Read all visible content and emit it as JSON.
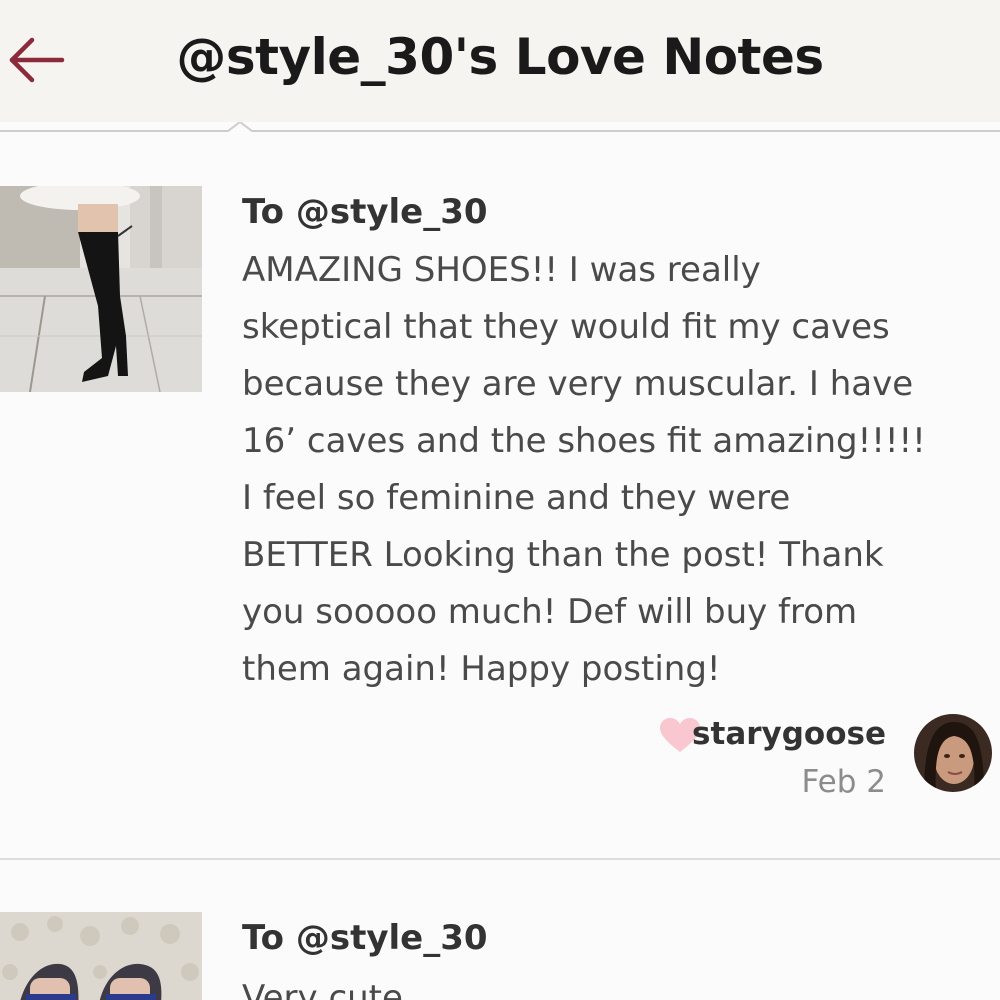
{
  "header": {
    "title": "@style_30's Love Notes",
    "back_icon": "left-arrow-icon",
    "accent_color": "#8b2a3a"
  },
  "notes": [
    {
      "to": "To @style_30",
      "body_lines": [
        "AMAZING SHOES!! I was really",
        "skeptical that they would fit my caves",
        "because they are very muscular. I have",
        "16’ caves and the shoes fit amazing!!!!!",
        "I feel so feminine and they were",
        "BETTER Looking than the post! Thank",
        "you sooooo much! Def will buy from",
        "them again! Happy posting!"
      ],
      "author": "starygoose",
      "date": "Feb 2",
      "heart_icon": "heart-icon",
      "heart_color": "#f9c7cf"
    },
    {
      "to": "To @style_30",
      "body_lines": [
        "Very cute"
      ]
    }
  ]
}
